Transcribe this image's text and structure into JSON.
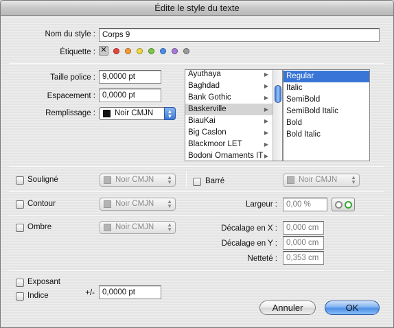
{
  "window": {
    "title": "Édite le style du texte"
  },
  "style_name": {
    "label": "Nom du style :",
    "value": "Corps 9"
  },
  "tag": {
    "label": "Étiquette :",
    "colors": [
      "#e8443a",
      "#f59a2e",
      "#f0d93a",
      "#7ac943",
      "#4a8de8",
      "#a67ad8",
      "#9a9a9a"
    ]
  },
  "font_size": {
    "label": "Taille police :",
    "value": "9,0000 pt"
  },
  "spacing": {
    "label": "Espacement :",
    "value": "0,0000 pt"
  },
  "fill": {
    "label": "Remplissage :",
    "value": "Noir CMJN"
  },
  "font_families": [
    "Ayuthaya",
    "Baghdad",
    "Bank Gothic",
    "Baskerville",
    "BiauKai",
    "Big Caslon",
    "Blackmoor LET",
    "Bodoni Ornaments IT"
  ],
  "font_family_selected": "Baskerville",
  "font_styles": [
    "Regular",
    "Italic",
    "SemiBold",
    "SemiBold Italic",
    "Bold",
    "Bold Italic"
  ],
  "font_style_selected": "Regular",
  "underline": {
    "label": "Souligné",
    "color": "Noir CMJN"
  },
  "strikethrough": {
    "label": "Barré",
    "color": "Noir CMJN"
  },
  "outline": {
    "label": "Contour",
    "color": "Noir CMJN",
    "width_label": "Largeur :",
    "width_value": "0,00 %"
  },
  "shadow": {
    "label": "Ombre",
    "color": "Noir CMJN",
    "offset_x_label": "Décalage  en X :",
    "offset_x_value": "0,000 cm",
    "offset_y_label": "Décalage  en Y :",
    "offset_y_value": "0,000 cm",
    "sharpness_label": "Netteté :",
    "sharpness_value": "0,353 cm"
  },
  "superscript": {
    "label": "Exposant"
  },
  "subscript": {
    "label": "Indice"
  },
  "baseline": {
    "label": "+/-",
    "value": "0,0000 pt"
  },
  "buttons": {
    "cancel": "Annuler",
    "ok": "OK"
  }
}
